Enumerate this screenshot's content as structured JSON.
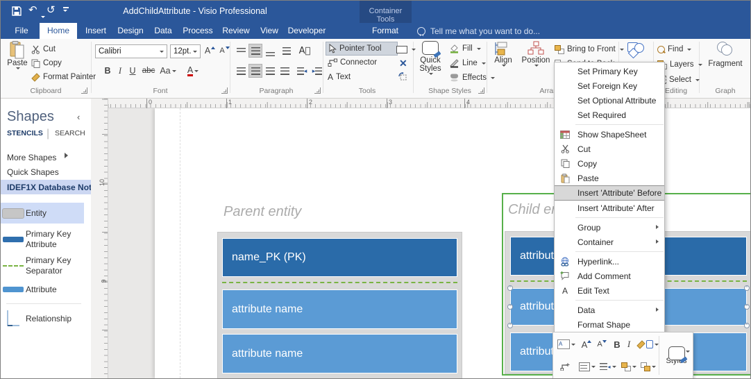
{
  "titlebar": {
    "title": "AddChildAttribute - Visio Professional",
    "context_group": "Container Tools"
  },
  "tabs": {
    "file": "File",
    "home": "Home",
    "insert": "Insert",
    "design": "Design",
    "data": "Data",
    "process": "Process",
    "review": "Review",
    "view": "View",
    "developer": "Developer",
    "format": "Format"
  },
  "tellme": "Tell me what you want to do...",
  "ribbon": {
    "clipboard": {
      "label": "Clipboard",
      "paste": "Paste",
      "cut": "Cut",
      "copy": "Copy",
      "format_painter": "Format Painter"
    },
    "font": {
      "label": "Font",
      "family": "Calibri",
      "size": "12pt.",
      "grow": "A",
      "shrink": "A",
      "bold": "B",
      "italic": "I",
      "underline": "U",
      "strikethrough": "abc",
      "case": "Aa",
      "color": "A"
    },
    "paragraph": {
      "label": "Paragraph"
    },
    "tools": {
      "label": "Tools",
      "pointer_tool": "Pointer Tool",
      "connector": "Connector",
      "text": "Text",
      "text_letter": "A",
      "delete": "✕"
    },
    "shape_styles": {
      "label": "Shape Styles",
      "quick_styles": "Quick Styles",
      "fill": "Fill",
      "line": "Line",
      "effects": "Effects"
    },
    "arrange": {
      "label": "Arrange",
      "align": "Align",
      "position": "Position",
      "bring_to_front": "Bring to Front",
      "send_to_back": "Send to Back"
    },
    "editing": {
      "label": "Editing",
      "find": "Find",
      "layers": "Layers",
      "select": "Select"
    },
    "graph": {
      "label": "Graph",
      "fragment": "Fragment"
    }
  },
  "shapes_panel": {
    "title": "Shapes",
    "collapse": "‹",
    "stencils_tab": "STENCILS",
    "search_tab": "SEARCH",
    "more_shapes": "More Shapes",
    "quick_shapes": "Quick Shapes",
    "active_stencil": "IDEF1X Database Not...",
    "items": [
      {
        "label": "Entity"
      },
      {
        "label": "Primary Key Attribute"
      },
      {
        "label": "Primary Key Separator"
      },
      {
        "label": "Attribute"
      },
      {
        "label": "Relationship"
      }
    ]
  },
  "rulers": {
    "horizontal": [
      "0",
      "1",
      "2",
      "3",
      "4"
    ],
    "vertical": [
      "10",
      "9"
    ]
  },
  "canvas": {
    "parent_entity": {
      "title": "Parent entity",
      "primary_key": "name_PK (PK)",
      "attributes": [
        "attribute name",
        "attribute name"
      ]
    },
    "child_entity": {
      "title": "Child entity",
      "rows": [
        "attribute name",
        "attribute name",
        "attribute name"
      ]
    }
  },
  "context_menu": {
    "items": [
      {
        "label": "Set Primary Key"
      },
      {
        "label": "Set Foreign Key"
      },
      {
        "label": "Set Optional Attribute"
      },
      {
        "label": "Set Required"
      },
      {
        "separator": true
      },
      {
        "label": "Show ShapeSheet",
        "icon": "shapesheet-icon"
      },
      {
        "label": "Cut",
        "icon": "scissors-icon"
      },
      {
        "label": "Copy",
        "icon": "copy-icon"
      },
      {
        "label": "Paste",
        "icon": "paste-icon"
      },
      {
        "label": "Insert 'Attribute' Before",
        "highlighted": true
      },
      {
        "label": "Insert 'Attribute' After"
      },
      {
        "separator": true
      },
      {
        "label": "Group",
        "submenu": true
      },
      {
        "label": "Container",
        "submenu": true
      },
      {
        "separator": true
      },
      {
        "label": "Hyperlink...",
        "icon": "hyperlink-icon"
      },
      {
        "label": "Add Comment",
        "icon": "comment-icon"
      },
      {
        "label": "Edit Text",
        "icon": "edit-text-icon",
        "icon_letter": "A"
      },
      {
        "separator": true
      },
      {
        "label": "Data",
        "submenu": true
      },
      {
        "label": "Format Shape"
      }
    ]
  },
  "mini_toolbar": {
    "styles": "Styles",
    "bold": "B",
    "italic": "I",
    "grow": "A",
    "shrink": "A",
    "data_card": "A"
  },
  "colors": {
    "titlebar_blue": "#2b579a",
    "context_tab_bg": "#264a83",
    "entity_dark_blue": "#2a6ba9",
    "entity_light_blue": "#5b9bd5",
    "pk_separator_green": "#79b342",
    "container_selection_green": "#57b04a",
    "menu_highlight": "#d8d8d8",
    "entity_title_gray": "#ababab"
  }
}
